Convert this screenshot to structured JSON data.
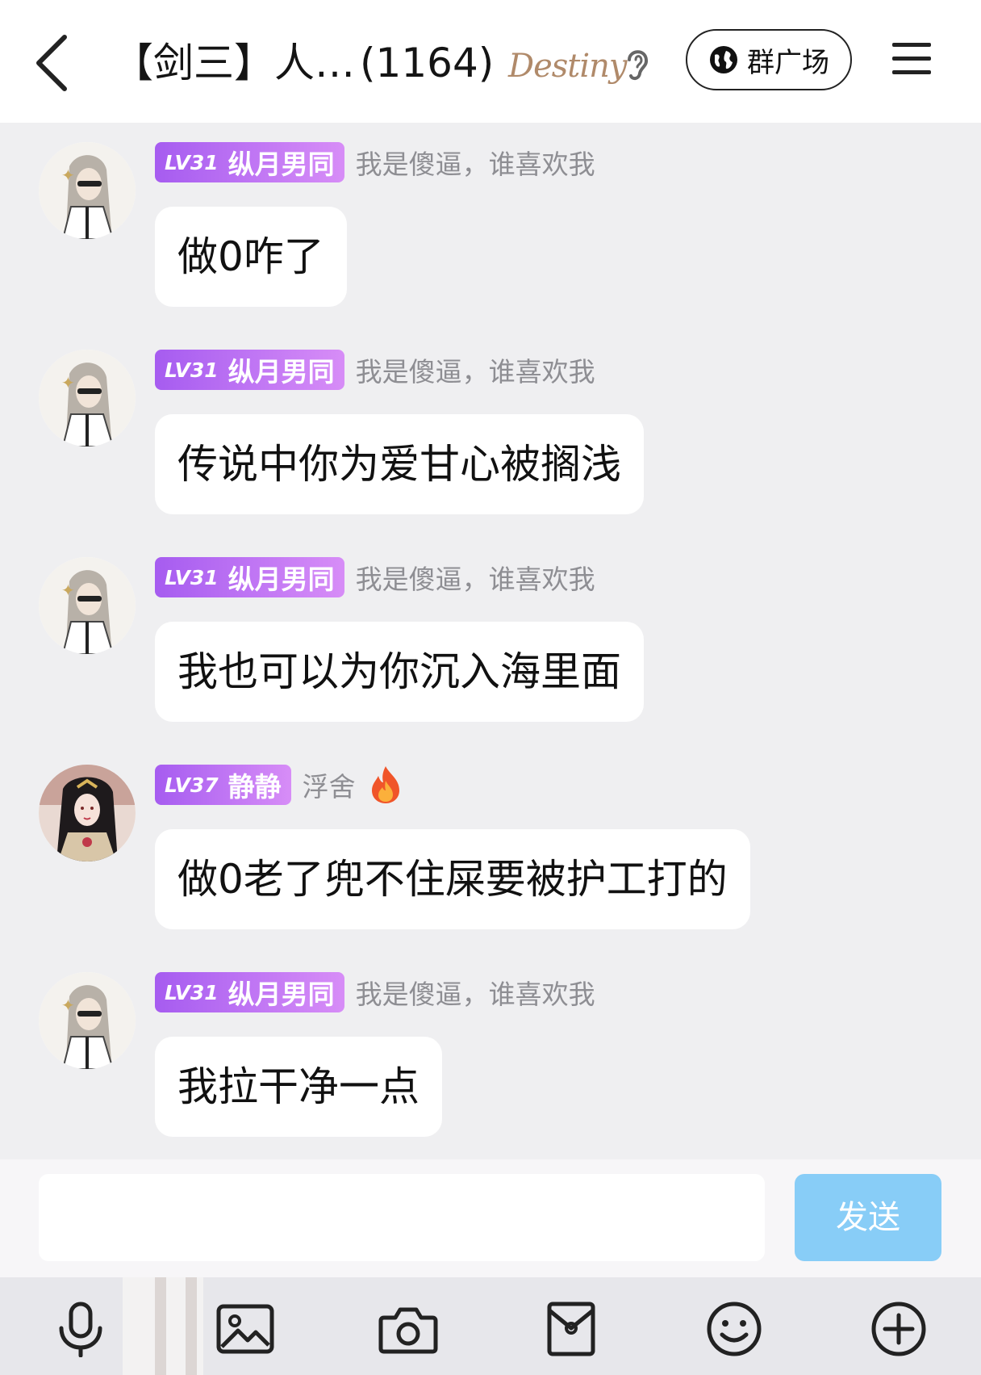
{
  "header": {
    "title": "【剑三】人…",
    "member_count": "(1164)",
    "logo_text": "Destiny",
    "plaza_label": "群广场"
  },
  "messages": [
    {
      "level": "LV31",
      "nickname": "纵月男同",
      "tag": "我是傻逼，谁喜欢我",
      "text": "做0咋了"
    },
    {
      "level": "LV31",
      "nickname": "纵月男同",
      "tag": "我是傻逼，谁喜欢我",
      "text": "传说中你为爱甘心被搁浅"
    },
    {
      "level": "LV31",
      "nickname": "纵月男同",
      "tag": "我是傻逼，谁喜欢我",
      "text": "我也可以为你沉入海里面"
    },
    {
      "level": "LV37",
      "nickname": "静静",
      "tag": "浮舍",
      "text": "做0老了兜不住屎要被护工打的"
    },
    {
      "level": "LV31",
      "nickname": "纵月男同",
      "tag": "我是傻逼，谁喜欢我",
      "text": "我拉干净一点"
    }
  ],
  "composer": {
    "input_value": "",
    "send_label": "发送"
  },
  "toolbar": {
    "icons": [
      "microphone-icon",
      "image-icon",
      "camera-icon",
      "red-packet-icon",
      "emoji-icon",
      "plus-icon"
    ]
  },
  "colors": {
    "background": "#efeff1",
    "badge_start": "#a65cf0",
    "badge_end": "#d78df7",
    "send_button": "#88cdf7"
  }
}
